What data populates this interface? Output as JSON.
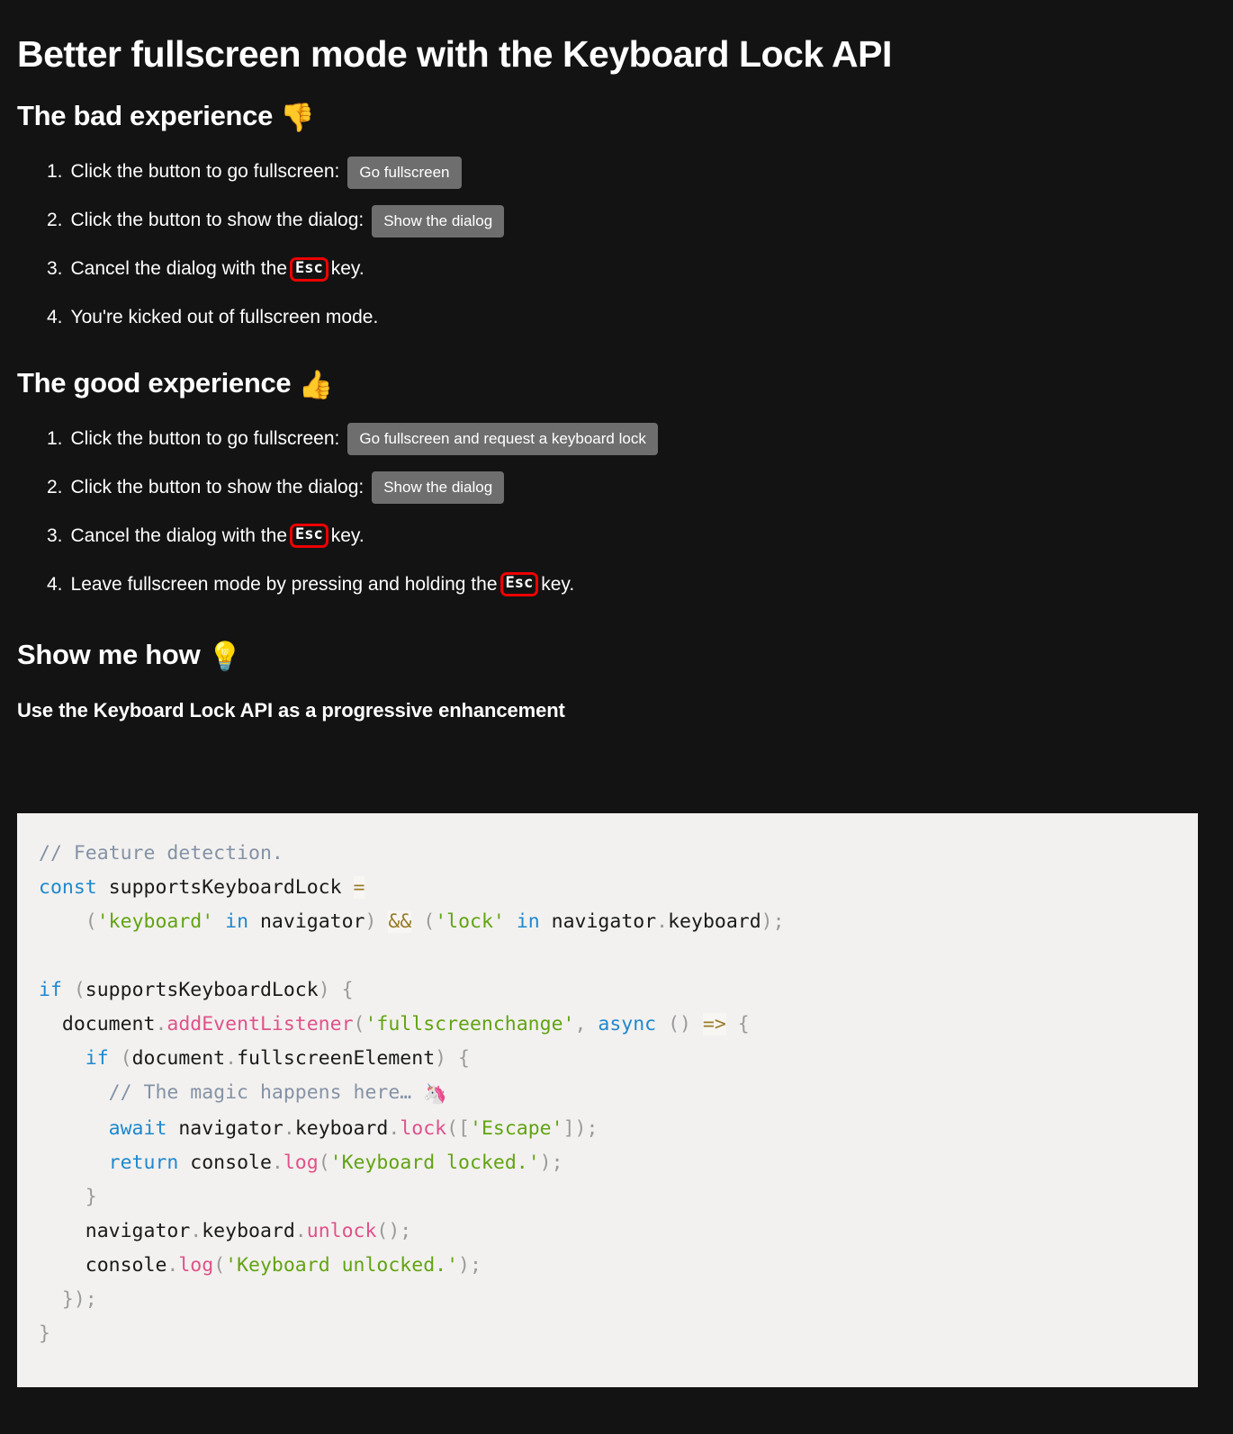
{
  "page": {
    "background_color": "#131313",
    "text_color": "#ffffff",
    "title": "Better fullscreen mode with the Keyboard Lock API"
  },
  "sections": {
    "bad": {
      "heading_text": "The bad experience",
      "heading_emoji": "👎",
      "steps": [
        {
          "marker": "1.",
          "text_before": "Click the button to go fullscreen:",
          "button": "Go fullscreen"
        },
        {
          "marker": "2.",
          "text_before": "Click the button to show the dialog:",
          "button": "Show the dialog"
        },
        {
          "marker": "3.",
          "text_before": "Cancel the dialog with the",
          "kbd": "Esc",
          "text_after": "key."
        },
        {
          "marker": "4.",
          "text_before": "You're kicked out of fullscreen mode."
        }
      ]
    },
    "good": {
      "heading_text": "The good experience",
      "heading_emoji": "👍",
      "steps": [
        {
          "marker": "1.",
          "text_before": "Click the button to go fullscreen:",
          "button": "Go fullscreen and request a keyboard lock"
        },
        {
          "marker": "2.",
          "text_before": "Click the button to show the dialog:",
          "button": "Show the dialog"
        },
        {
          "marker": "3.",
          "text_before": "Cancel the dialog with the",
          "kbd": "Esc",
          "text_after": "key."
        },
        {
          "marker": "4.",
          "text_before": "Leave fullscreen mode by pressing and holding the",
          "kbd": "Esc",
          "text_after": "key."
        }
      ]
    },
    "howto": {
      "heading_text": "Show me how",
      "heading_emoji": "💡",
      "sub_heading": "Use the Keyboard Lock API as a progressive enhancement"
    }
  },
  "code": {
    "background_color": "#f2f1ef",
    "language": "javascript",
    "colors": {
      "comment": "#8492a6",
      "keyword": "#1e88cf",
      "string": "#62a312",
      "function": "#e0518a",
      "operator": "#9a7a2a",
      "punctuation": "#9a9a9a",
      "plain": "#1a1a1a"
    },
    "lines": [
      "// Feature detection.",
      "const supportsKeyboardLock =",
      "    ('keyboard' in navigator) && ('lock' in navigator.keyboard);",
      "",
      "if (supportsKeyboardLock) {",
      "  document.addEventListener('fullscreenchange', async () => {",
      "    if (document.fullscreenElement) {",
      "      // The magic happens here… 🦄",
      "      await navigator.keyboard.lock(['Escape']);",
      "      return console.log('Keyboard locked.');",
      "    }",
      "    navigator.keyboard.unlock();",
      "    console.log('Keyboard unlocked.');",
      "  });",
      "}"
    ]
  }
}
